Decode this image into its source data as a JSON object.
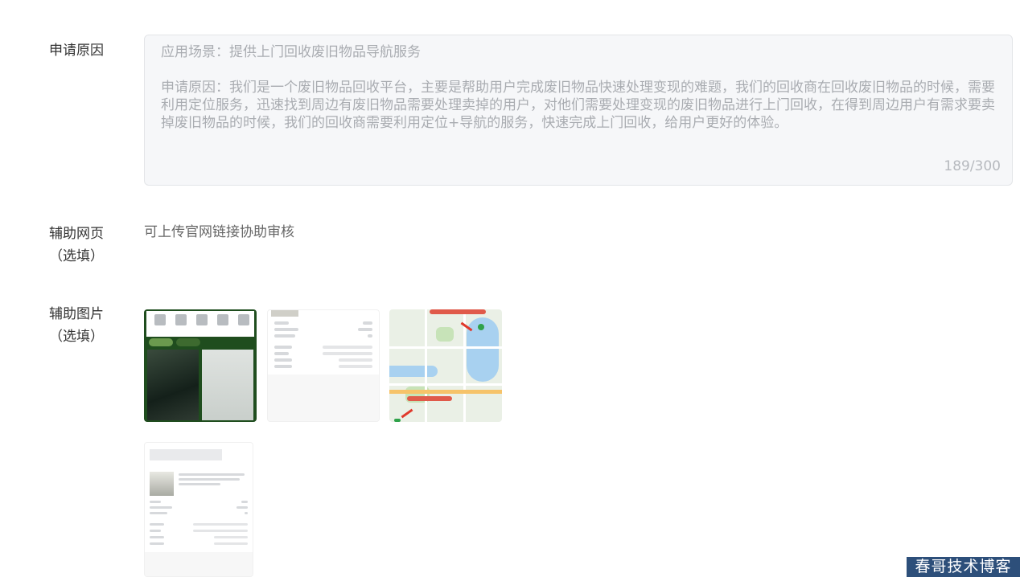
{
  "form": {
    "reason_label": "申请原因",
    "reason_line1": "应用场景：提供上门回收废旧物品导航服务",
    "reason_line2": "申请原因：我们是一个废旧物品回收平台，主要是帮助用户完成废旧物品快速处理变现的难题，我们的回收商在回收废旧物品的时候，需要利用定位服务，迅速找到周边有废旧物品需要处理卖掉的用户，对他们需要处理变现的废旧物品进行上门回收，在得到周边用户有需求要卖掉废旧物品的时候，我们的回收商需要利用定位+导航的服务，快速完成上门回收，给用户更好的体验。",
    "reason_counter": "189/300",
    "web_label": "辅助网页",
    "web_label_optional": "（选填）",
    "web_hint": "可上传官网链接协助审核",
    "image_label": "辅助图片",
    "image_label_optional": "（选填）"
  },
  "watermark": "春哥技术博客"
}
